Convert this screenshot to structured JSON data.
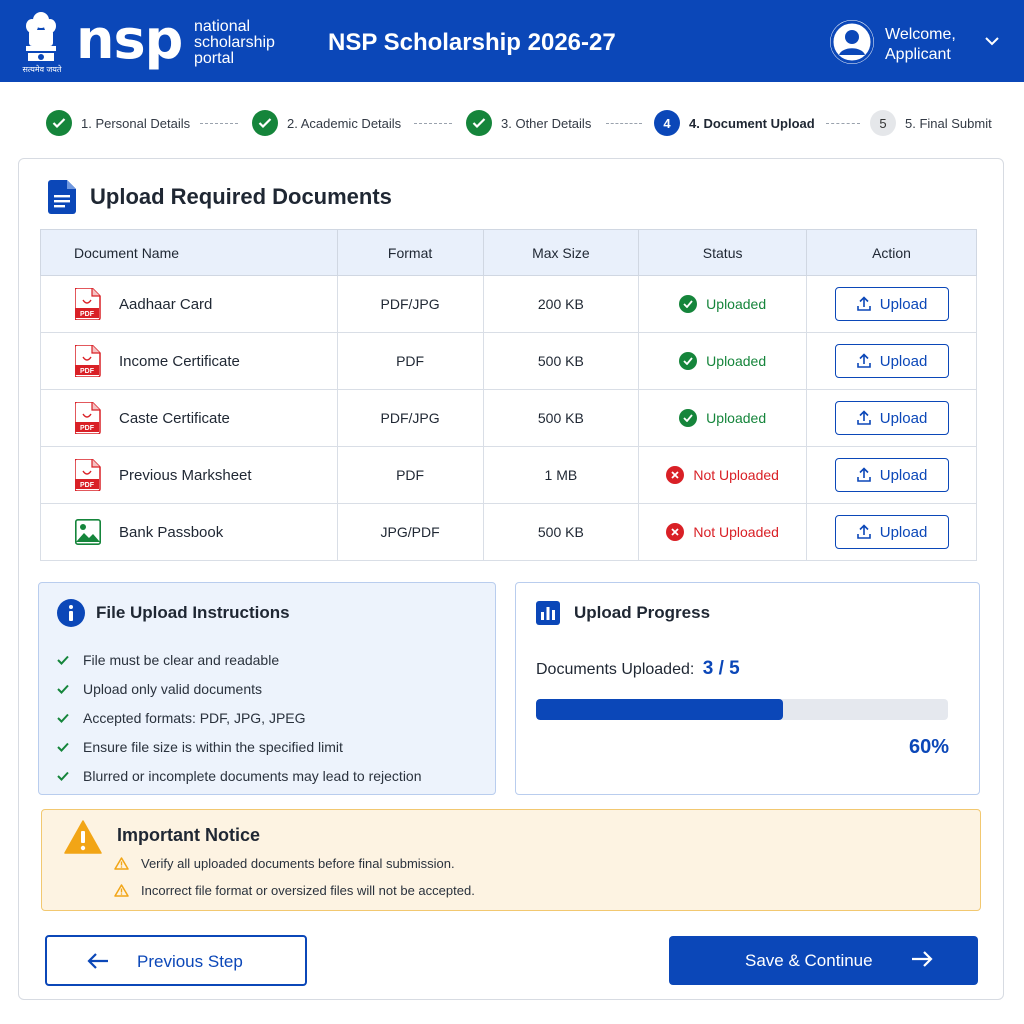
{
  "header": {
    "emblem_text": "सत्यमेव जयते",
    "logo_main": "nsp",
    "logo_sub": [
      "national",
      "scholarship",
      "portal"
    ],
    "title": "NSP Scholarship 2026-27",
    "welcome_line1": "Welcome,",
    "welcome_line2": "Applicant"
  },
  "stepper": {
    "steps": [
      {
        "label": "1. Personal Details",
        "state": "done"
      },
      {
        "label": "2. Academic Details",
        "state": "done"
      },
      {
        "label": "3. Other Details",
        "state": "done"
      },
      {
        "number": "4",
        "label": "4. Document Upload",
        "state": "active"
      },
      {
        "number": "5",
        "label": "5. Final Submit",
        "state": "todo"
      }
    ]
  },
  "documents": {
    "title": "Upload Required Documents",
    "columns": [
      "Document Name",
      "Format",
      "Max Size",
      "Status",
      "Action"
    ],
    "rows": [
      {
        "name": "Aadhaar Card",
        "format": "PDF/JPG",
        "max_size": "200 KB",
        "status": "Uploaded",
        "action": "Upload",
        "icon": "pdf-file-icon"
      },
      {
        "name": "Income Certificate",
        "format": "PDF",
        "max_size": "500 KB",
        "status": "Uploaded",
        "action": "Upload",
        "icon": "pdf-file-icon"
      },
      {
        "name": "Caste Certificate",
        "format": "PDF/JPG",
        "max_size": "500 KB",
        "status": "Uploaded",
        "action": "Upload",
        "icon": "pdf-file-icon"
      },
      {
        "name": "Previous Marksheet",
        "format": "PDF",
        "max_size": "1 MB",
        "status": "Not Uploaded",
        "action": "Upload",
        "icon": "pdf-file-icon"
      },
      {
        "name": "Bank Passbook",
        "format": "JPG/PDF",
        "max_size": "500 KB",
        "status": "Not Uploaded",
        "action": "Upload",
        "icon": "image-file-icon"
      }
    ]
  },
  "instructions": {
    "title": "File Upload Instructions",
    "items": [
      "File must be clear and readable",
      "Upload only valid documents",
      "Accepted formats: PDF, JPG, JPEG",
      "Ensure file size is within the specified limit",
      "Blurred or incomplete documents may lead to rejection"
    ]
  },
  "progress": {
    "title": "Upload Progress",
    "label": "Documents Uploaded:",
    "count": "3 / 5",
    "percent_text": "60%",
    "fraction": 0.6
  },
  "notice": {
    "title": "Important Notice",
    "items": [
      "Verify all uploaded documents before final submission.",
      "Incorrect file format or oversized files will not be accepted."
    ]
  },
  "footer": {
    "prev_label": "Previous Step",
    "next_label": "Save & Continue"
  },
  "colors": {
    "primary": "#0b47b8",
    "success": "#15853b",
    "danger": "#d92026",
    "warning": "#f2a516"
  }
}
